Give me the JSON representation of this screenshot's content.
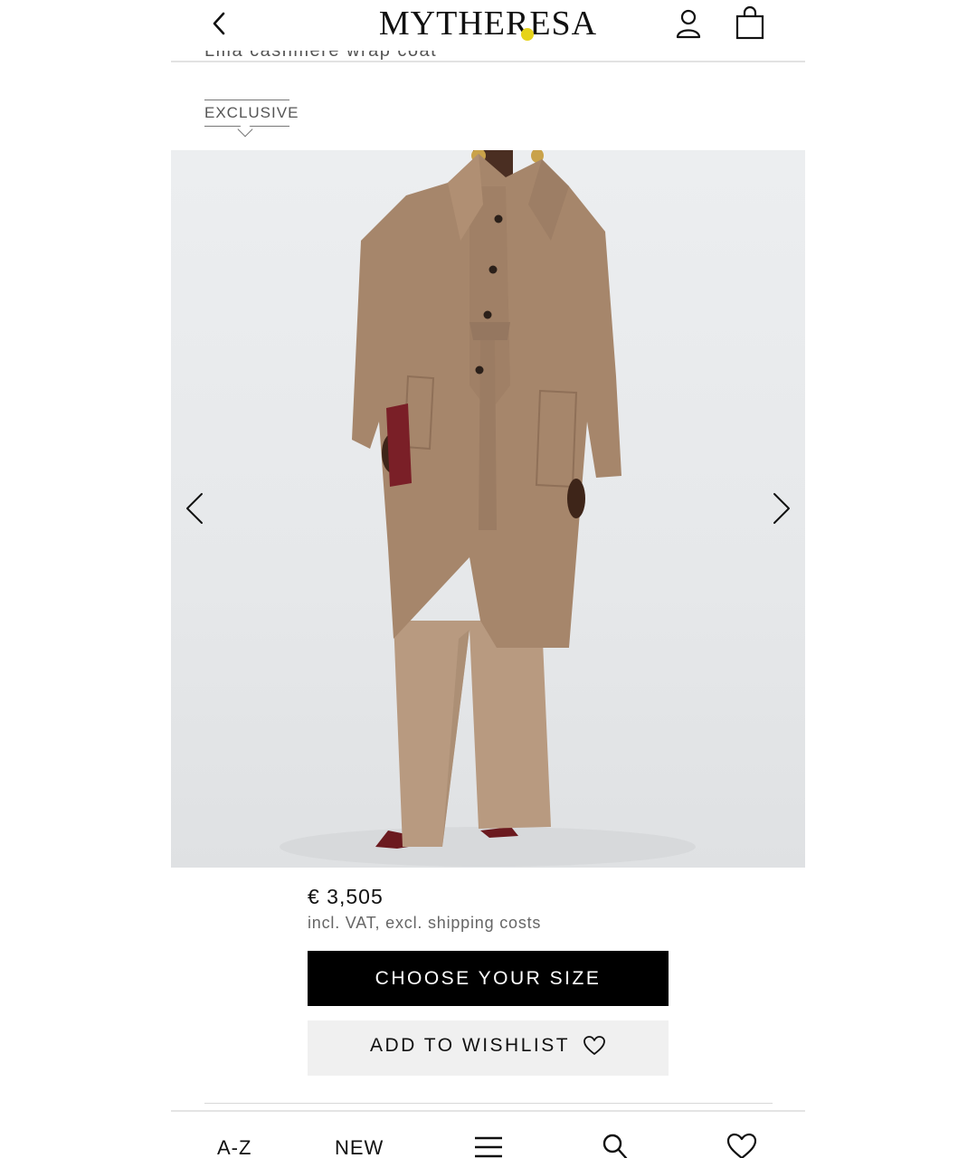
{
  "header": {
    "logo": "MYTHERESA",
    "back_icon": "chevron-left-icon",
    "account_icon": "user-icon",
    "bag_icon": "shopping-bag-icon",
    "notification_dot_color": "#e6d31a"
  },
  "product": {
    "title_cut": "Lilia cashmere wrap coat",
    "badge": "EXCLUSIVE",
    "image_alt_icon": "product-photo",
    "price": "€ 3,505",
    "vat_note": "incl. VAT, excl. shipping costs",
    "choose_size_label": "CHOOSE YOUR SIZE",
    "wishlist_label": "ADD TO WISHLIST"
  },
  "gallery": {
    "prev_icon": "chevron-left-icon",
    "next_icon": "chevron-right-icon"
  },
  "bottom_nav": {
    "az_label": "A-Z",
    "new_label": "NEW",
    "menu_icon": "hamburger-menu-icon",
    "search_icon": "search-icon",
    "wishlist_icon": "heart-icon"
  },
  "colors": {
    "primary_button": "#000000",
    "secondary_button": "#f0f0f0",
    "coat": "#a6866b"
  }
}
